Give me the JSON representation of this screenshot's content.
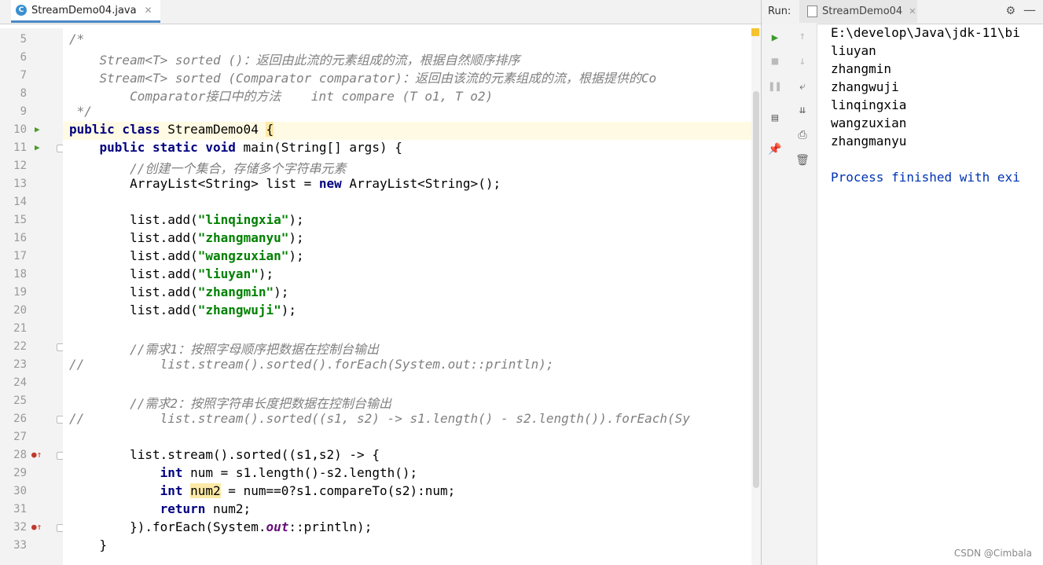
{
  "editor": {
    "tab_label": "StreamDemo04.java",
    "tab_icon": "C",
    "lines": [
      {
        "num": "5"
      },
      {
        "num": "6"
      },
      {
        "num": "7"
      },
      {
        "num": "8"
      },
      {
        "num": "9"
      },
      {
        "num": "10"
      },
      {
        "num": "11"
      },
      {
        "num": "12"
      },
      {
        "num": "13"
      },
      {
        "num": "14"
      },
      {
        "num": "15"
      },
      {
        "num": "16"
      },
      {
        "num": "17"
      },
      {
        "num": "18"
      },
      {
        "num": "19"
      },
      {
        "num": "20"
      },
      {
        "num": "21"
      },
      {
        "num": "22"
      },
      {
        "num": "23"
      },
      {
        "num": "24"
      },
      {
        "num": "25"
      },
      {
        "num": "26"
      },
      {
        "num": "27"
      },
      {
        "num": "28"
      },
      {
        "num": "29"
      },
      {
        "num": "30"
      },
      {
        "num": "31"
      },
      {
        "num": "32"
      },
      {
        "num": "33"
      }
    ],
    "code": {
      "l5": "/*",
      "l6": "    Stream<T> sorted ()：返回由此流的元素组成的流，根据自然顺序排序",
      "l7": "    Stream<T> sorted (Comparator comparator)：返回由该流的元素组成的流，根据提供的Co",
      "l8": "        Comparator接口中的方法    int compare (T o1, T o2)",
      "l9": " */",
      "l10_a": "public class",
      "l10_b": " StreamDemo04 ",
      "l10_c": "{",
      "l11_a": "    public static void",
      "l11_b": " main(String[] args) {",
      "l12": "        //创建一个集合，存储多个字符串元素",
      "l13_a": "        ArrayList<String> list = ",
      "l13_b": "new",
      "l13_c": " ArrayList<String>();",
      "l15_a": "        list.add(",
      "l15_b": "\"linqingxia\"",
      "l15_c": ");",
      "l16_a": "        list.add(",
      "l16_b": "\"zhangmanyu\"",
      "l16_c": ");",
      "l17_a": "        list.add(",
      "l17_b": "\"wangzuxian\"",
      "l17_c": ");",
      "l18_a": "        list.add(",
      "l18_b": "\"liuyan\"",
      "l18_c": ");",
      "l19_a": "        list.add(",
      "l19_b": "\"zhangmin\"",
      "l19_c": ");",
      "l20_a": "        list.add(",
      "l20_b": "\"zhangwuji\"",
      "l20_c": ");",
      "l22": "        //需求1：按照字母顺序把数据在控制台输出",
      "l23": "//          list.stream().sorted().forEach(System.out::println);",
      "l25": "        //需求2：按照字符串长度把数据在控制台输出",
      "l26": "//          list.stream().sorted((s1, s2) -> s1.length() - s2.length()).forEach(Sy",
      "l28": "        list.stream().sorted((s1,s2) -> {",
      "l29_a": "            int",
      "l29_b": " num = s1.length()-s2.length();",
      "l30_a": "            int",
      "l30_b": " ",
      "l30_c": "num2",
      "l30_d": " = num==0?s1.compareTo(s2):num;",
      "l31_a": "            return",
      "l31_b": " num2;",
      "l32_a": "        }).forEach(System.",
      "l32_b": "out",
      "l32_c": "::println);",
      "l33": "    }"
    }
  },
  "run": {
    "label": "Run:",
    "tab_label": "StreamDemo04",
    "console": [
      "E:\\develop\\Java\\jdk-11\\bi",
      "liuyan",
      "zhangmin",
      "zhangwuji",
      "linqingxia",
      "wangzuxian",
      "zhangmanyu",
      "",
      "Process finished with exi"
    ]
  },
  "icons": {
    "run": "play-icon",
    "stop": "stop-icon",
    "pause": "pause-icon",
    "up": "arrow-up-icon",
    "down": "arrow-down-icon",
    "wrap": "soft-wrap-icon",
    "scroll": "scroll-to-end-icon",
    "print": "print-icon",
    "trash": "trash-icon",
    "pin": "pin-icon",
    "layout": "layout-icon",
    "settings": "gear-icon",
    "minimize": "minimize-icon"
  },
  "watermark": "CSDN @Cimbala"
}
